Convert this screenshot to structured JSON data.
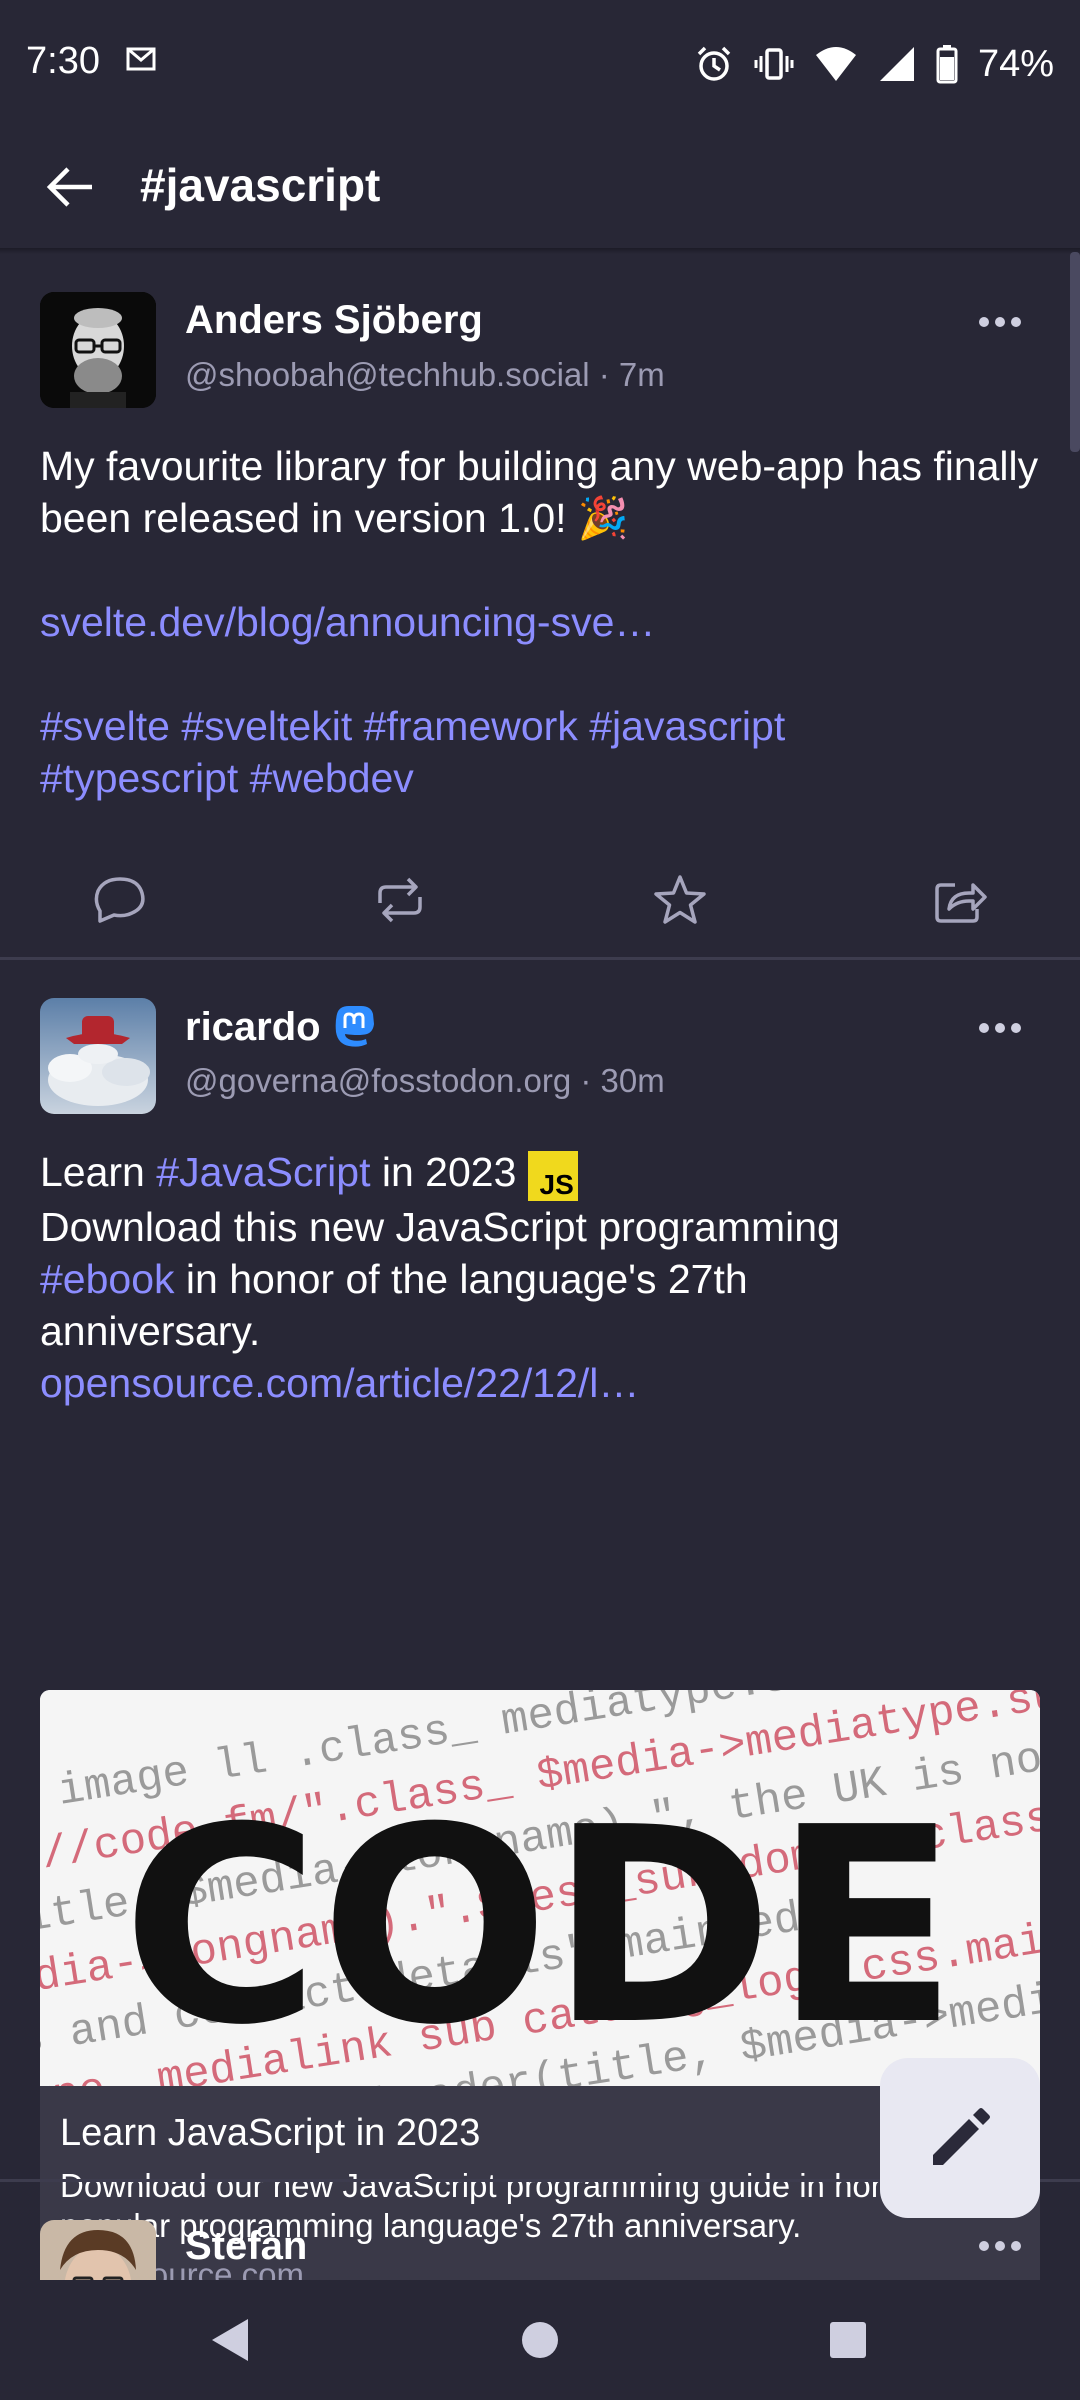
{
  "status_bar": {
    "time": "7:30",
    "battery": "74%",
    "icons": [
      "mail-icon",
      "alarm-icon",
      "vibrate-icon",
      "wifi-icon",
      "signal-icon",
      "battery-icon"
    ]
  },
  "app_bar": {
    "title": "#javascript",
    "back_icon": "arrow-left-icon"
  },
  "posts": [
    {
      "display_name": "Anders Sjöberg",
      "handle": "@shoobah@techhub.social · 7m",
      "text": "My favourite library for building any web-app has finally been released in version 1.0! 🎉",
      "link": "svelte.dev/blog/announcing-sve…",
      "hashtags": [
        "#svelte",
        "#sveltekit",
        "#framework",
        "#javascript",
        "#typescript",
        "#webdev"
      ]
    },
    {
      "display_name": "ricardo",
      "handle": "@governa@fosstodon.org · 30m",
      "text_line1_pre": "Learn ",
      "text_line1_tag": "#JavaScript",
      "text_line1_post": " in 2023 ",
      "js_badge": "JS",
      "text_line2": "Download this new JavaScript programming",
      "text_line3_tag": "#ebook",
      "text_line3_post": " in honor of the language's 27th",
      "text_line4": "anniversary.",
      "link": "opensource.com/article/22/12/l…",
      "card": {
        "image_word": "CODE",
        "title": "Learn JavaScript in 2023",
        "description": "Download our new JavaScript programming guide in honor of the popular programming language's 27th anniversary.",
        "domain": "opensource.com"
      }
    },
    {
      "display_name": "Stefan"
    }
  ],
  "colors": {
    "background": "#282736",
    "link": "#8c8dff",
    "secondary_text": "#9c9bb3",
    "fab": "#e8e8f2"
  }
}
